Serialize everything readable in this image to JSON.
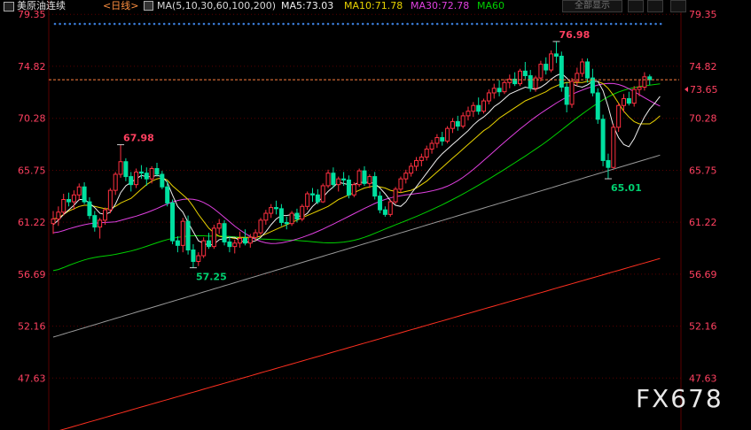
{
  "header": {
    "symbol": "美原油连续",
    "period": "<日线>",
    "ma_params": "MA(5,10,30,60,100,200)",
    "ma5": "MA5:73.03",
    "ma10": "MA10:71.78",
    "ma30": "MA30:72.78",
    "ma60": "MA60",
    "all_button": "全部显示",
    "colors": {
      "ma5": "#f0f0f0",
      "ma10": "#e8d200",
      "ma30": "#e040e0",
      "ma60": "#00d000",
      "ma100": "#9a9a9a",
      "ma200": "#ff3020"
    }
  },
  "watermark": "FX678",
  "current_price": "73.65",
  "price_annotations": [
    {
      "label": "67.98",
      "color": "#ff4060"
    },
    {
      "label": "57.25",
      "color": "#00d070"
    },
    {
      "label": "76.98",
      "color": "#ff4060"
    },
    {
      "label": "65.01",
      "color": "#00d070"
    }
  ],
  "chart_data": {
    "type": "candlestick",
    "ylim": [
      43.1,
      80.6
    ],
    "y_ticks": [
      "79.35",
      "74.82",
      "70.28",
      "65.75",
      "61.22",
      "56.69",
      "52.16",
      "47.63"
    ],
    "colors": {
      "up": "#ff3040",
      "down": "#00e0a0",
      "grid": "#5a0000",
      "axis": "#ff4060",
      "price_line": "#ff8040"
    },
    "price_line": 73.65,
    "ohlc": [
      [
        61.1,
        62.2,
        60.2,
        61.5
      ],
      [
        61.5,
        62.6,
        60.9,
        62.1
      ],
      [
        62.1,
        63.7,
        61.8,
        63.2
      ],
      [
        63.2,
        63.8,
        62.6,
        63.0
      ],
      [
        63.0,
        64.0,
        62.3,
        63.6
      ],
      [
        63.6,
        64.6,
        63.1,
        64.3
      ],
      [
        64.3,
        64.7,
        62.8,
        63.0
      ],
      [
        63.0,
        63.4,
        61.5,
        61.8
      ],
      [
        61.8,
        62.2,
        60.4,
        60.8
      ],
      [
        60.8,
        61.6,
        59.8,
        61.4
      ],
      [
        61.4,
        62.5,
        61.0,
        62.3
      ],
      [
        62.3,
        64.2,
        62.0,
        64.0
      ],
      [
        64.0,
        65.6,
        63.6,
        65.4
      ],
      [
        65.4,
        67.98,
        65.1,
        66.5
      ],
      [
        66.5,
        66.8,
        64.8,
        65.2
      ],
      [
        65.2,
        65.6,
        63.9,
        64.5
      ],
      [
        64.5,
        65.9,
        64.2,
        65.6
      ],
      [
        65.6,
        66.2,
        65.0,
        65.5
      ],
      [
        65.5,
        66.0,
        64.4,
        65.0
      ],
      [
        65.0,
        66.1,
        64.6,
        65.9
      ],
      [
        65.9,
        66.4,
        65.2,
        65.4
      ],
      [
        65.4,
        65.7,
        64.1,
        64.3
      ],
      [
        64.3,
        64.8,
        62.6,
        62.9
      ],
      [
        62.9,
        63.2,
        59.3,
        59.6
      ],
      [
        59.6,
        60.0,
        58.6,
        59.2
      ],
      [
        59.2,
        61.6,
        58.6,
        61.3
      ],
      [
        61.3,
        61.8,
        58.4,
        58.8
      ],
      [
        58.8,
        59.3,
        57.25,
        57.8
      ],
      [
        57.8,
        58.6,
        57.4,
        58.3
      ],
      [
        58.3,
        59.9,
        58.1,
        59.6
      ],
      [
        59.6,
        60.3,
        58.9,
        59.1
      ],
      [
        59.1,
        61.0,
        58.9,
        60.7
      ],
      [
        60.7,
        61.5,
        60.2,
        61.1
      ],
      [
        61.1,
        61.4,
        59.2,
        59.5
      ],
      [
        59.5,
        60.0,
        58.6,
        59.1
      ],
      [
        59.1,
        59.7,
        58.5,
        59.4
      ],
      [
        59.4,
        60.4,
        59.0,
        59.8
      ],
      [
        59.8,
        60.6,
        59.2,
        59.4
      ],
      [
        59.4,
        60.2,
        59.0,
        59.9
      ],
      [
        59.9,
        60.6,
        59.6,
        60.3
      ],
      [
        60.3,
        61.6,
        60.1,
        61.4
      ],
      [
        61.4,
        62.3,
        61.0,
        62.0
      ],
      [
        62.0,
        62.8,
        61.6,
        62.5
      ],
      [
        62.5,
        63.1,
        61.9,
        62.4
      ],
      [
        62.4,
        62.8,
        60.9,
        61.2
      ],
      [
        61.2,
        61.7,
        60.6,
        61.1
      ],
      [
        61.1,
        62.2,
        60.9,
        62.0
      ],
      [
        62.0,
        62.4,
        61.2,
        61.5
      ],
      [
        61.5,
        62.8,
        61.3,
        62.6
      ],
      [
        62.6,
        63.9,
        62.3,
        63.7
      ],
      [
        63.7,
        64.2,
        63.0,
        63.6
      ],
      [
        63.6,
        64.1,
        62.8,
        63.0
      ],
      [
        63.0,
        64.6,
        62.9,
        64.4
      ],
      [
        64.4,
        65.8,
        64.2,
        65.5
      ],
      [
        65.5,
        66.0,
        64.2,
        64.5
      ],
      [
        64.5,
        65.2,
        63.9,
        65.0
      ],
      [
        65.0,
        65.6,
        64.4,
        64.9
      ],
      [
        64.9,
        65.3,
        63.3,
        63.6
      ],
      [
        63.6,
        64.7,
        63.4,
        64.5
      ],
      [
        64.5,
        65.9,
        64.3,
        65.7
      ],
      [
        65.7,
        66.1,
        64.4,
        64.6
      ],
      [
        64.6,
        65.4,
        64.2,
        65.2
      ],
      [
        65.2,
        65.6,
        63.2,
        63.5
      ],
      [
        63.5,
        63.9,
        62.0,
        62.3
      ],
      [
        62.3,
        62.6,
        61.7,
        61.9
      ],
      [
        61.9,
        63.2,
        61.7,
        63.0
      ],
      [
        63.0,
        64.3,
        62.8,
        64.1
      ],
      [
        64.1,
        65.2,
        63.8,
        65.0
      ],
      [
        65.0,
        65.8,
        64.6,
        65.5
      ],
      [
        65.5,
        66.4,
        65.2,
        66.1
      ],
      [
        66.1,
        66.9,
        65.7,
        66.6
      ],
      [
        66.6,
        67.2,
        66.1,
        66.9
      ],
      [
        66.9,
        67.9,
        66.6,
        67.6
      ],
      [
        67.6,
        68.4,
        67.2,
        68.1
      ],
      [
        68.1,
        68.9,
        67.7,
        68.6
      ],
      [
        68.6,
        69.1,
        67.9,
        68.3
      ],
      [
        68.3,
        69.6,
        68.1,
        69.4
      ],
      [
        69.4,
        70.3,
        69.0,
        70.0
      ],
      [
        70.0,
        70.5,
        69.2,
        69.6
      ],
      [
        69.6,
        70.8,
        69.4,
        70.5
      ],
      [
        70.5,
        71.3,
        70.1,
        70.9
      ],
      [
        70.9,
        71.7,
        70.4,
        71.4
      ],
      [
        71.4,
        72.1,
        70.6,
        70.9
      ],
      [
        70.9,
        72.0,
        70.7,
        71.8
      ],
      [
        71.8,
        72.8,
        71.5,
        72.5
      ],
      [
        72.5,
        73.3,
        72.0,
        72.9
      ],
      [
        72.9,
        73.6,
        72.2,
        72.6
      ],
      [
        72.6,
        73.7,
        72.4,
        73.4
      ],
      [
        73.4,
        74.1,
        72.9,
        73.7
      ],
      [
        73.7,
        74.3,
        73.1,
        73.3
      ],
      [
        73.3,
        74.6,
        73.1,
        74.4
      ],
      [
        74.4,
        75.2,
        73.7,
        74.0
      ],
      [
        74.0,
        74.5,
        72.6,
        72.9
      ],
      [
        72.9,
        74.0,
        72.6,
        73.8
      ],
      [
        73.8,
        75.3,
        73.5,
        75.0
      ],
      [
        75.0,
        75.6,
        74.1,
        74.5
      ],
      [
        74.5,
        76.2,
        74.3,
        75.9
      ],
      [
        75.9,
        76.98,
        75.1,
        75.7
      ],
      [
        75.7,
        76.1,
        72.6,
        73.0
      ],
      [
        73.0,
        73.4,
        70.8,
        71.5
      ],
      [
        71.5,
        73.8,
        71.2,
        73.5
      ],
      [
        73.5,
        74.7,
        73.1,
        74.2
      ],
      [
        74.2,
        75.5,
        73.9,
        75.2
      ],
      [
        75.2,
        75.5,
        73.4,
        73.8
      ],
      [
        73.8,
        74.6,
        72.2,
        72.5
      ],
      [
        72.5,
        72.9,
        69.8,
        70.2
      ],
      [
        70.2,
        70.6,
        66.1,
        66.6
      ],
      [
        66.6,
        67.2,
        65.01,
        66.0
      ],
      [
        66.0,
        69.8,
        65.9,
        69.5
      ],
      [
        69.5,
        71.6,
        69.1,
        71.4
      ],
      [
        71.4,
        72.4,
        70.8,
        72.0
      ],
      [
        72.0,
        72.6,
        71.4,
        71.6
      ],
      [
        71.6,
        73.1,
        71.3,
        72.8
      ],
      [
        72.8,
        73.6,
        72.2,
        73.0
      ],
      [
        73.0,
        74.3,
        72.7,
        73.9
      ],
      [
        73.9,
        74.1,
        73.2,
        73.65
      ]
    ],
    "ma5": [
      61.0,
      61.4,
      61.9,
      62.3,
      62.7,
      63.2,
      63.2,
      62.9,
      62.5,
      62.0,
      61.9,
      62.1,
      62.8,
      63.8,
      64.4,
      64.7,
      65.0,
      65.3,
      65.2,
      65.2,
      65.3,
      65.2,
      64.7,
      63.6,
      62.6,
      62.1,
      61.2,
      60.4,
      59.6,
      59.4,
      59.2,
      59.3,
      59.7,
      59.8,
      59.9,
      59.9,
      59.6,
      59.5,
      59.5,
      59.6,
      59.9,
      60.4,
      61.0,
      61.5,
      61.8,
      61.8,
      61.9,
      61.8,
      61.7,
      62.0,
      62.6,
      63.0,
      63.4,
      63.9,
      64.3,
      64.7,
      64.6,
      64.5,
      64.5,
      64.7,
      64.7,
      64.7,
      64.6,
      64.2,
      63.7,
      63.1,
      62.7,
      62.6,
      63.0,
      63.7,
      64.3,
      64.9,
      65.5,
      66.1,
      66.7,
      67.2,
      67.6,
      68.0,
      68.4,
      68.8,
      69.2,
      69.7,
      70.1,
      70.4,
      70.8,
      71.3,
      71.6,
      72.0,
      72.4,
      72.6,
      72.8,
      73.0,
      72.9,
      72.8,
      73.0,
      73.3,
      73.7,
      74.0,
      74.2,
      73.8,
      73.3,
      73.1,
      73.0,
      73.2,
      73.5,
      73.5,
      72.7,
      71.3,
      69.6,
      68.6,
      68.0,
      67.8,
      68.5,
      69.5,
      70.4,
      71.1,
      71.6,
      72.2
    ],
    "ma10": [
      61.5,
      61.6,
      61.9,
      62.2,
      62.4,
      62.6,
      62.7,
      62.7,
      62.6,
      62.5,
      62.4,
      62.4,
      62.6,
      62.9,
      63.1,
      63.3,
      63.7,
      64.1,
      64.5,
      64.8,
      65.0,
      65.1,
      64.9,
      64.4,
      64.0,
      63.6,
      63.2,
      62.6,
      61.9,
      61.3,
      60.7,
      60.3,
      60.0,
      59.9,
      59.9,
      59.8,
      59.9,
      59.9,
      59.9,
      59.9,
      60.0,
      60.2,
      60.4,
      60.6,
      60.8,
      61.0,
      61.2,
      61.4,
      61.6,
      61.8,
      62.0,
      62.2,
      62.4,
      62.6,
      62.9,
      63.2,
      63.4,
      63.6,
      63.8,
      64.0,
      64.2,
      64.3,
      64.4,
      64.3,
      64.2,
      64.0,
      63.9,
      63.8,
      63.9,
      64.0,
      64.2,
      64.5,
      64.8,
      65.2,
      65.6,
      66.0,
      66.4,
      66.8,
      67.2,
      67.6,
      68.0,
      68.4,
      68.8,
      69.2,
      69.5,
      69.9,
      70.3,
      70.6,
      70.9,
      71.2,
      71.5,
      71.8,
      72.0,
      72.2,
      72.4,
      72.6,
      72.9,
      73.1,
      73.3,
      73.4,
      73.4,
      73.4,
      73.4,
      73.5,
      73.5,
      73.5,
      73.3,
      72.9,
      72.3,
      71.6,
      70.9,
      70.4,
      70.0,
      69.8,
      69.8,
      69.8,
      70.1,
      70.5
    ]
  }
}
